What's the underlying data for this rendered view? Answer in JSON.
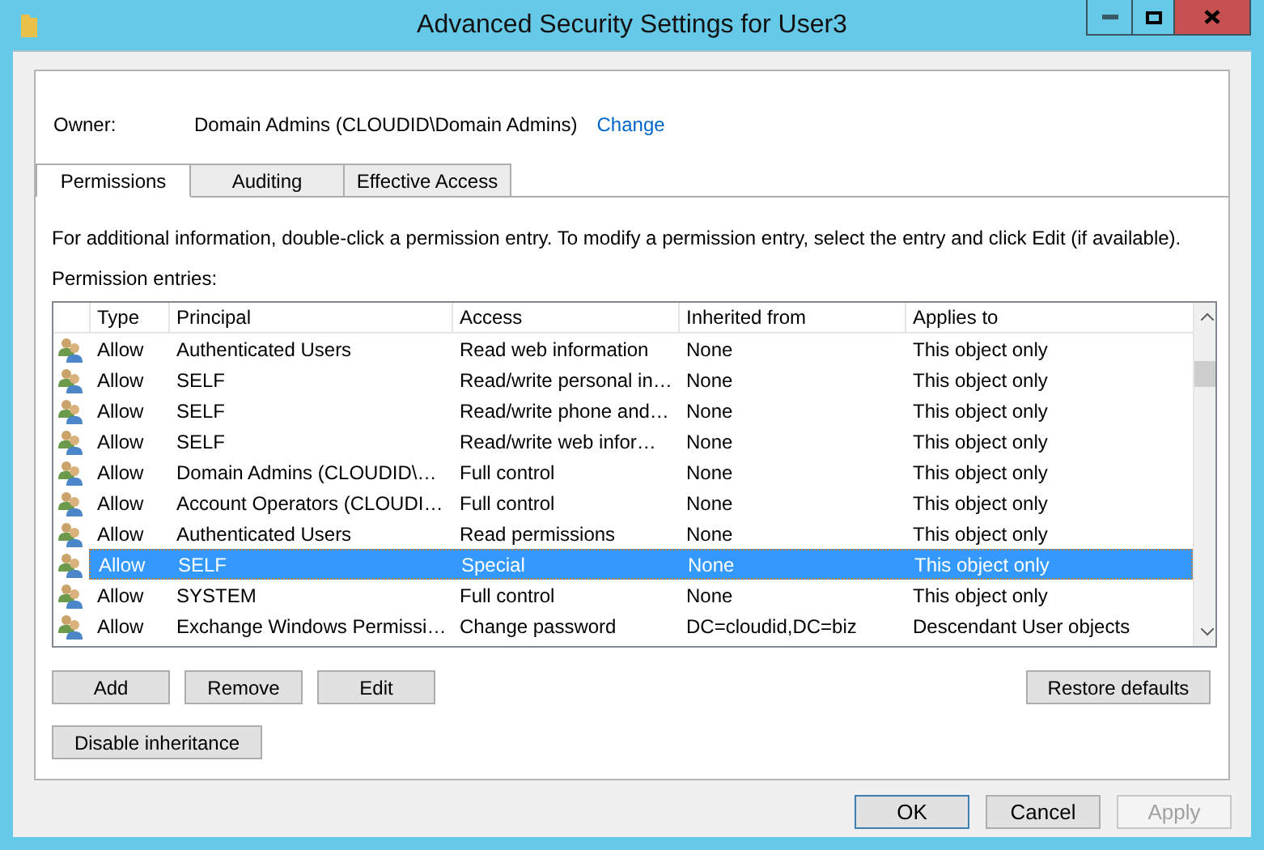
{
  "window": {
    "title": "Advanced Security Settings for User3"
  },
  "owner": {
    "label": "Owner:",
    "value": "Domain Admins (CLOUDID\\Domain Admins)",
    "link": "Change"
  },
  "tabs": [
    {
      "label": "Permissions",
      "selected": true
    },
    {
      "label": "Auditing",
      "selected": false
    },
    {
      "label": "Effective Access",
      "selected": false
    }
  ],
  "info": "For additional information, double-click a permission entry. To modify a permission entry, select the entry and click Edit (if available).",
  "entries_label": "Permission entries:",
  "table": {
    "columns": [
      "Type",
      "Principal",
      "Access",
      "Inherited from",
      "Applies to"
    ],
    "rows": [
      {
        "type": "Allow",
        "principal": "Authenticated Users",
        "access": "Read web information",
        "inherited": "None",
        "applies": "This object only",
        "selected": false
      },
      {
        "type": "Allow",
        "principal": "SELF",
        "access": "Read/write personal in…",
        "inherited": "None",
        "applies": "This object only",
        "selected": false
      },
      {
        "type": "Allow",
        "principal": "SELF",
        "access": "Read/write phone and…",
        "inherited": "None",
        "applies": "This object only",
        "selected": false
      },
      {
        "type": "Allow",
        "principal": "SELF",
        "access": "Read/write web infor…",
        "inherited": "None",
        "applies": "This object only",
        "selected": false
      },
      {
        "type": "Allow",
        "principal": "Domain Admins (CLOUDID\\…",
        "access": "Full control",
        "inherited": "None",
        "applies": "This object only",
        "selected": false
      },
      {
        "type": "Allow",
        "principal": "Account Operators (CLOUDI…",
        "access": "Full control",
        "inherited": "None",
        "applies": "This object only",
        "selected": false
      },
      {
        "type": "Allow",
        "principal": "Authenticated Users",
        "access": "Read permissions",
        "inherited": "None",
        "applies": "This object only",
        "selected": false
      },
      {
        "type": "Allow",
        "principal": "SELF",
        "access": "Special",
        "inherited": "None",
        "applies": "This object only",
        "selected": true
      },
      {
        "type": "Allow",
        "principal": "SYSTEM",
        "access": "Full control",
        "inherited": "None",
        "applies": "This object only",
        "selected": false
      },
      {
        "type": "Allow",
        "principal": "Exchange Windows Permissi…",
        "access": "Change password",
        "inherited": "DC=cloudid,DC=biz",
        "applies": "Descendant User objects",
        "selected": false
      }
    ]
  },
  "entry_buttons": [
    "Add",
    "Remove",
    "Edit"
  ],
  "restore_button": "Restore defaults",
  "inheritance_button": "Disable inheritance",
  "dialog_buttons": [
    {
      "label": "OK",
      "disabled": false,
      "default": true
    },
    {
      "label": "Cancel",
      "disabled": false,
      "default": false
    },
    {
      "label": "Apply",
      "disabled": true,
      "default": false
    }
  ]
}
